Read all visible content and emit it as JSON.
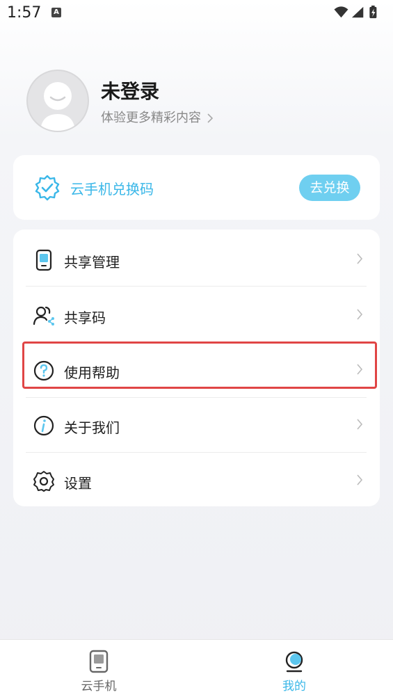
{
  "status_bar": {
    "time": "1:57",
    "notification_letter": "A"
  },
  "profile": {
    "username": "未登录",
    "subtitle": "体验更多精彩内容"
  },
  "redeem": {
    "label": "云手机兑换码",
    "button": "去兑换"
  },
  "menu": {
    "items": [
      {
        "label": "共享管理",
        "icon": "tablet-icon"
      },
      {
        "label": "共享码",
        "icon": "users-share-icon"
      },
      {
        "label": "使用帮助",
        "icon": "help-circle-icon"
      },
      {
        "label": "关于我们",
        "icon": "info-circle-icon"
      },
      {
        "label": "设置",
        "icon": "gear-icon"
      }
    ]
  },
  "tabbar": {
    "tabs": [
      {
        "label": "云手机",
        "icon": "tablet-icon",
        "active": false
      },
      {
        "label": "我的",
        "icon": "person-icon",
        "active": true
      }
    ]
  },
  "colors": {
    "accent": "#3ab7e8",
    "button": "#6fcff0",
    "highlight": "#e04545",
    "active_tab": "#3ab7e8",
    "inactive_tab": "#666666"
  }
}
